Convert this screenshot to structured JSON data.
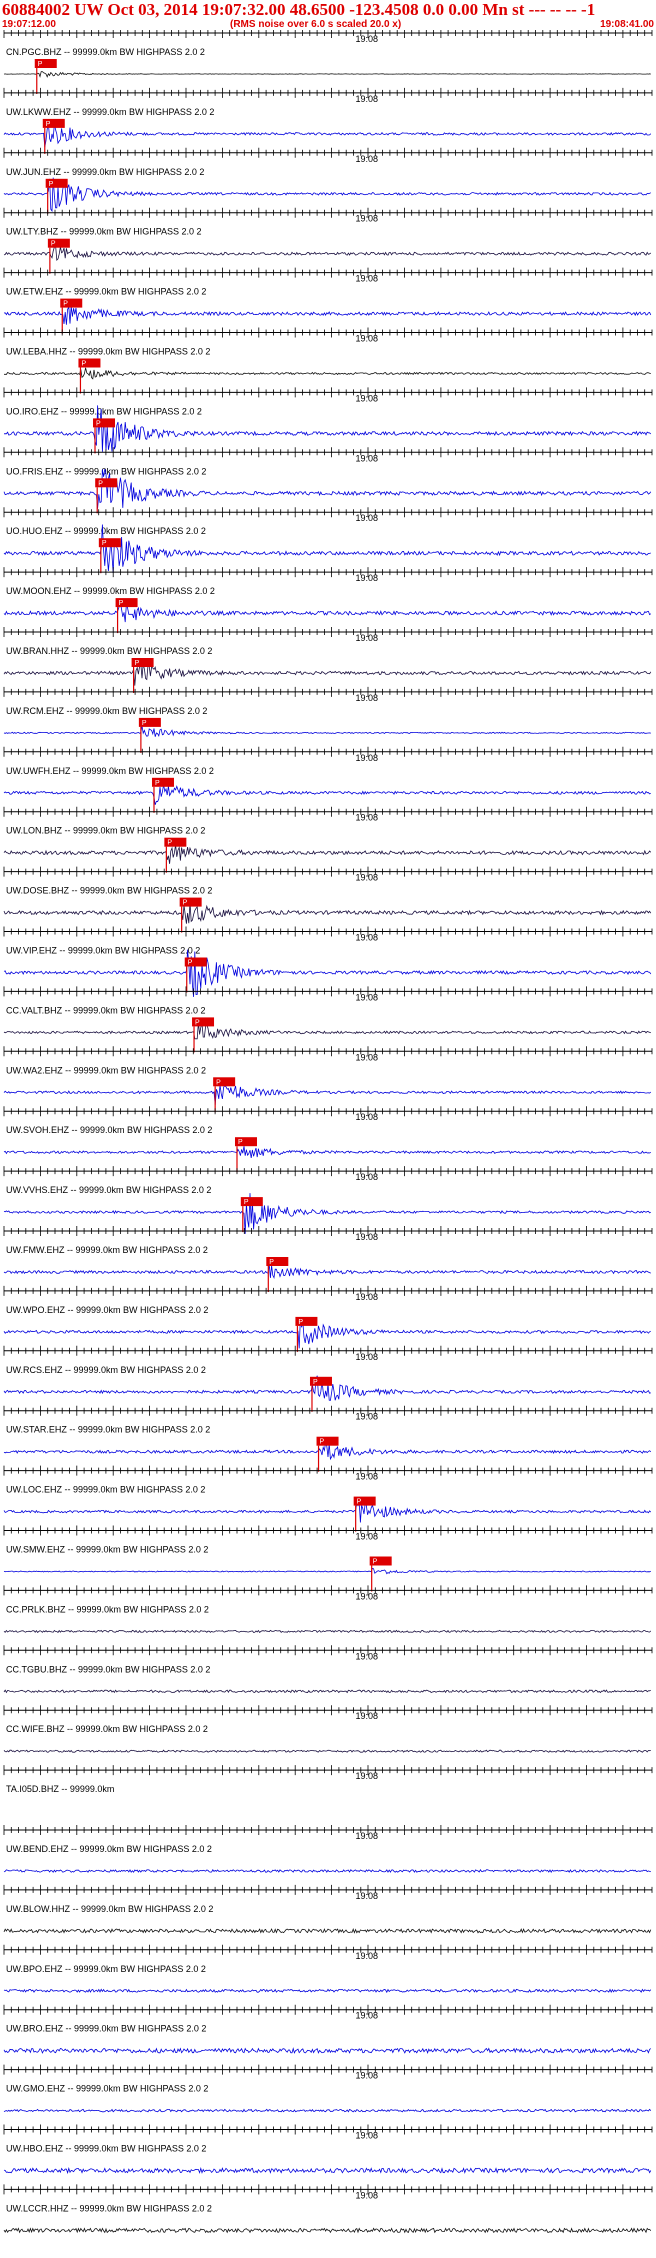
{
  "header": {
    "title": "60884002 UW Oct 03, 2014 19:07:32.00   48.6500 -123.4508  0.0 0.00 Mn st --- -- --  -1",
    "start_time": "19:07:12.00",
    "note": "(RMS noise over 6.0 s scaled 20.0 x)",
    "end_time": "19:08:41.00"
  },
  "chart_data": {
    "type": "seismogram",
    "time_start": "19:07:12.00",
    "time_end": "19:08:41.00",
    "minute_mark_label": "19:08",
    "pick_label": "P",
    "colors": {
      "blue": "#0000dd",
      "black": "#111111",
      "navy": "#1a1040",
      "pick": "#dd0000"
    },
    "traces": [
      {
        "label": "CN.PGC.BHZ -- 99999.0km BW  HIGHPASS  2.0  2",
        "color": "black",
        "amp": 0.3,
        "noise": 0.05,
        "pick": 4.5
      },
      {
        "label": "UW.LKWW.EHZ -- 99999.0km BW  HIGHPASS  2.0  2",
        "color": "blue",
        "amp": 1.0,
        "noise": 0.3,
        "pick": 5.6
      },
      {
        "label": "UW.JUN.EHZ -- 99999.0km BW  HIGHPASS  2.0  2",
        "color": "blue",
        "amp": 1.6,
        "noise": 0.3,
        "pick": 6.0
      },
      {
        "label": "UW.LTY.BHZ -- 99999.0km BW  HIGHPASS  2.0  2",
        "color": "navy",
        "amp": 0.6,
        "noise": 0.35,
        "pick": 6.3
      },
      {
        "label": "UW.ETW.EHZ -- 99999.0km BW  HIGHPASS  2.0  2",
        "color": "blue",
        "amp": 0.9,
        "noise": 0.4,
        "pick": 8.0
      },
      {
        "label": "UW.LEBA.HHZ -- 99999.0km BW  HIGHPASS  2.0  2",
        "color": "black",
        "amp": 0.5,
        "noise": 0.25,
        "pick": 10.5
      },
      {
        "label": "UO.IRO.EHZ -- 99999.0km BW  HIGHPASS  2.0  2",
        "color": "blue",
        "amp": 2.5,
        "noise": 0.45,
        "pick": 12.5
      },
      {
        "label": "UO.FRIS.EHZ -- 99999.0km BW  HIGHPASS  2.0  2",
        "color": "blue",
        "amp": 2.5,
        "noise": 0.45,
        "pick": 12.8
      },
      {
        "label": "UO.HUO.EHZ -- 99999.0km BW  HIGHPASS  2.0  2",
        "color": "blue",
        "amp": 2.5,
        "noise": 0.45,
        "pick": 13.3
      },
      {
        "label": "UW.MOON.EHZ -- 99999.0km BW  HIGHPASS  2.0  2",
        "color": "blue",
        "amp": 0.8,
        "noise": 0.45,
        "pick": 15.6
      },
      {
        "label": "UW.BRAN.HHZ -- 99999.0km BW  HIGHPASS  2.0  2",
        "color": "navy",
        "amp": 0.9,
        "noise": 0.4,
        "pick": 17.8
      },
      {
        "label": "UW.RCM.EHZ -- 99999.0km BW  HIGHPASS  2.0  2",
        "color": "blue",
        "amp": 0.5,
        "noise": 0.15,
        "pick": 18.8
      },
      {
        "label": "UW.UWFH.EHZ -- 99999.0km BW  HIGHPASS  2.0  2",
        "color": "blue",
        "amp": 0.9,
        "noise": 0.35,
        "pick": 20.6
      },
      {
        "label": "UW.LON.BHZ -- 99999.0km BW  HIGHPASS  2.0  2",
        "color": "navy",
        "amp": 0.8,
        "noise": 0.45,
        "pick": 22.3
      },
      {
        "label": "UW.DOSE.BHZ -- 99999.0km BW  HIGHPASS  2.0  2",
        "color": "navy",
        "amp": 1.0,
        "noise": 0.45,
        "pick": 24.4
      },
      {
        "label": "UW.VIP.EHZ -- 99999.0km BW  HIGHPASS  2.0  2",
        "color": "blue",
        "amp": 2.2,
        "noise": 0.4,
        "pick": 25.1
      },
      {
        "label": "CC.VALT.BHZ -- 99999.0km BW  HIGHPASS  2.0  2",
        "color": "navy",
        "amp": 0.8,
        "noise": 0.3,
        "pick": 26.1
      },
      {
        "label": "UW.WA2.EHZ -- 99999.0km BW  HIGHPASS  2.0  2",
        "color": "blue",
        "amp": 1.0,
        "noise": 0.3,
        "pick": 29.0
      },
      {
        "label": "UW.SVOH.EHZ -- 99999.0km BW  HIGHPASS  2.0  2",
        "color": "blue",
        "amp": 0.6,
        "noise": 0.3,
        "pick": 32.0
      },
      {
        "label": "UW.VVHS.EHZ -- 99999.0km BW  HIGHPASS  2.0  2",
        "color": "blue",
        "amp": 1.8,
        "noise": 0.3,
        "pick": 32.8
      },
      {
        "label": "UW.FMW.EHZ -- 99999.0km BW  HIGHPASS  2.0  2",
        "color": "blue",
        "amp": 0.6,
        "noise": 0.35,
        "pick": 36.3
      },
      {
        "label": "UW.WPO.EHZ -- 99999.0km BW  HIGHPASS  2.0  2",
        "color": "blue",
        "amp": 1.2,
        "noise": 0.35,
        "pick": 40.3
      },
      {
        "label": "UW.RCS.EHZ -- 99999.0km BW  HIGHPASS  2.0  2",
        "color": "blue",
        "amp": 1.3,
        "noise": 0.35,
        "pick": 42.3
      },
      {
        "label": "UW.STAR.EHZ -- 99999.0km BW  HIGHPASS  2.0  2",
        "color": "blue",
        "amp": 0.8,
        "noise": 0.35,
        "pick": 43.2
      },
      {
        "label": "UW.LOC.EHZ -- 99999.0km BW  HIGHPASS  2.0  2",
        "color": "blue",
        "amp": 1.0,
        "noise": 0.3,
        "pick": 48.3
      },
      {
        "label": "UW.SMW.EHZ -- 99999.0km BW  HIGHPASS  2.0  2",
        "color": "blue",
        "amp": 0.25,
        "noise": 0.12,
        "pick": 50.5
      },
      {
        "label": "CC.PRLK.BHZ -- 99999.0km BW  HIGHPASS  2.0  2",
        "color": "navy",
        "amp": 0.4,
        "noise": 0.25
      },
      {
        "label": "CC.TGBU.BHZ -- 99999.0km BW  HIGHPASS  2.0  2",
        "color": "navy",
        "amp": 0.4,
        "noise": 0.3
      },
      {
        "label": "CC.WIFE.BHZ -- 99999.0km BW  HIGHPASS  2.0  2",
        "color": "navy",
        "amp": 0.3,
        "noise": 0.25
      },
      {
        "label": "TA.I05D.BHZ -- 99999.0km",
        "color": "black",
        "amp": 0.0,
        "noise": 0.0
      },
      {
        "label": "UW.BEND.EHZ -- 99999.0km BW  HIGHPASS  2.0  2",
        "color": "blue",
        "amp": 0.3,
        "noise": 0.3
      },
      {
        "label": "UW.BLOW.HHZ -- 99999.0km BW  HIGHPASS  2.0  2",
        "color": "black",
        "amp": 0.4,
        "noise": 0.45
      },
      {
        "label": "UW.BPO.EHZ -- 99999.0km BW  HIGHPASS  2.0  2",
        "color": "blue",
        "amp": 0.3,
        "noise": 0.35
      },
      {
        "label": "UW.BRO.EHZ -- 99999.0km BW  HIGHPASS  2.0  2",
        "color": "blue",
        "amp": 0.4,
        "noise": 0.55
      },
      {
        "label": "UW.GMO.EHZ -- 99999.0km BW  HIGHPASS  2.0  2",
        "color": "blue",
        "amp": 0.3,
        "noise": 0.3
      },
      {
        "label": "UW.HBO.EHZ -- 99999.0km BW  HIGHPASS  2.0  2",
        "color": "blue",
        "amp": 0.4,
        "noise": 0.55
      },
      {
        "label": "UW.LCCR.HHZ -- 99999.0km BW  HIGHPASS  2.0  2",
        "color": "black",
        "amp": 0.5,
        "noise": 0.5
      }
    ]
  }
}
